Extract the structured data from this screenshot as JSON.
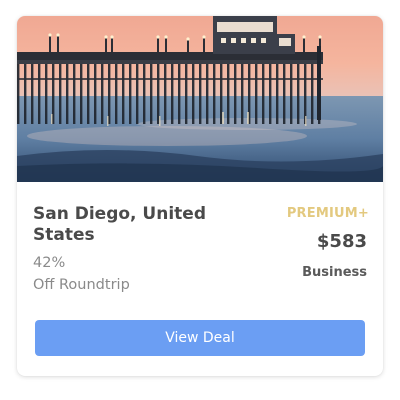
{
  "deal": {
    "city": "San Diego, United States",
    "discount": "42%",
    "discount_caption": "Off Roundtrip",
    "tier": "PREMIUM+",
    "price": "$583",
    "cabin": "Business",
    "cta_label": "View Deal"
  },
  "colors": {
    "tier_gold": "#e3c97f",
    "cta_blue": "#6b9ef3",
    "title_text": "#4a4a4a",
    "muted_text": "#8a8a8a"
  },
  "icons": []
}
